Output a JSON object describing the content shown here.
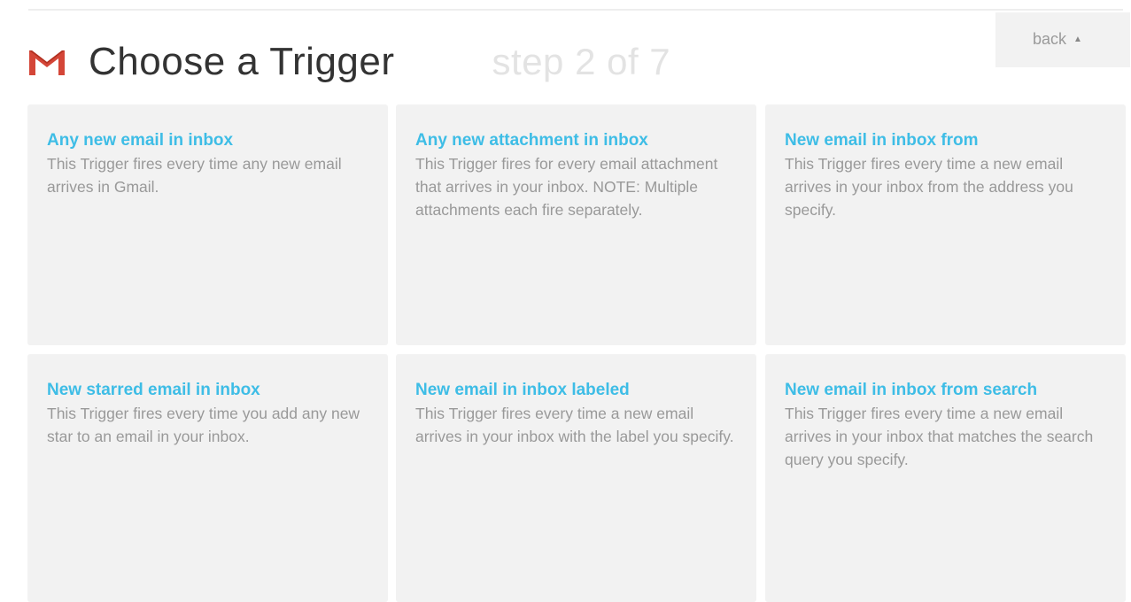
{
  "header": {
    "title": "Choose a Trigger",
    "step": "step 2 of 7",
    "service_icon": "gmail-icon"
  },
  "back": {
    "label": "back",
    "caret": "▲"
  },
  "colors": {
    "card_background": "#f2f2f2",
    "card_title": "#3ebde6",
    "card_description": "#999999",
    "page_title": "#333333",
    "step_label": "#e3e3e3",
    "gmail_red": "#d44638"
  },
  "triggers": [
    {
      "title": "Any new email in inbox",
      "description": "This Trigger fires every time any new email arrives in Gmail."
    },
    {
      "title": "Any new attachment in inbox",
      "description": "This Trigger fires for every email attachment that arrives in your inbox. NOTE: Multiple attachments each fire separately."
    },
    {
      "title": "New email in inbox from",
      "description": "This Trigger fires every time a new email arrives in your inbox from the address you specify."
    },
    {
      "title": "New starred email in inbox",
      "description": "This Trigger fires every time you add any new star to an email in your inbox."
    },
    {
      "title": "New email in inbox labeled",
      "description": "This Trigger fires every time a new email arrives in your inbox with the label you specify."
    },
    {
      "title": "New email in inbox from search",
      "description": "This Trigger fires every time a new email arrives in your inbox that matches the search query you specify."
    }
  ]
}
